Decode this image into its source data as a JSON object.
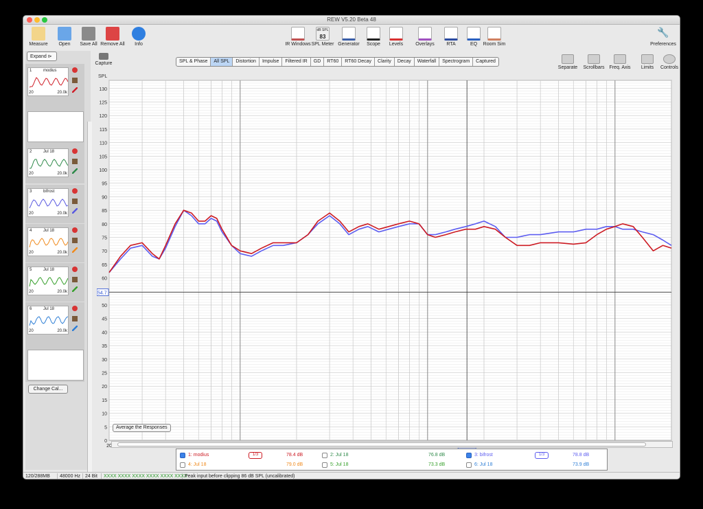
{
  "window": {
    "title": "REW V5.20 Beta 48"
  },
  "toolbar_left": [
    {
      "id": "measure",
      "label": "Measure",
      "icon": "measure-icon"
    },
    {
      "id": "open",
      "label": "Open",
      "icon": "folder-icon"
    },
    {
      "id": "save_all",
      "label": "Save All",
      "icon": "save-icon"
    },
    {
      "id": "remove_all",
      "label": "Remove All",
      "icon": "remove-icon"
    },
    {
      "id": "info",
      "label": "Info",
      "icon": "info-icon"
    }
  ],
  "toolbar_center": [
    {
      "id": "ir_windows",
      "label": "IR Windows",
      "icon": "ir-windows-icon"
    },
    {
      "id": "spl_meter",
      "label": "SPL Meter",
      "icon": "spl-meter-icon",
      "display": "83",
      "unit": "dB SPL"
    },
    {
      "id": "generator",
      "label": "Generator",
      "icon": "generator-icon"
    },
    {
      "id": "scope",
      "label": "Scope",
      "icon": "scope-icon"
    },
    {
      "id": "levels",
      "label": "Levels",
      "icon": "levels-icon"
    },
    {
      "id": "overlays",
      "label": "Overlays",
      "icon": "overlays-icon"
    },
    {
      "id": "rta",
      "label": "RTA",
      "icon": "rta-icon"
    },
    {
      "id": "eq",
      "label": "EQ",
      "icon": "eq-icon"
    },
    {
      "id": "room_sim",
      "label": "Room Sim",
      "icon": "room-sim-icon"
    }
  ],
  "preferences": {
    "label": "Preferences",
    "icon": "wrench-icon"
  },
  "capture": {
    "label": "Capture",
    "icon": "camera-icon"
  },
  "tabs": [
    "SPL & Phase",
    "All SPL",
    "Distortion",
    "Impulse",
    "Filtered IR",
    "GD",
    "RT60",
    "RT60 Decay",
    "Clarity",
    "Decay",
    "Waterfall",
    "Spectrogram",
    "Captured"
  ],
  "active_tab": "All SPL",
  "toolbar_right": [
    {
      "id": "separate",
      "label": "Separate",
      "icon": "separate-icon"
    },
    {
      "id": "scrollbars",
      "label": "Scrollbars",
      "icon": "scrollbars-icon"
    },
    {
      "id": "freq_axis",
      "label": "Freq. Axis",
      "icon": "freq-axis-icon"
    },
    {
      "id": "limits",
      "label": "Limits",
      "icon": "limits-icon"
    },
    {
      "id": "controls",
      "label": "Controls",
      "icon": "gear-icon"
    }
  ],
  "sidebar": {
    "expand_label": "Expand",
    "change_cal_label": "Change Cal...",
    "x_min": "20",
    "x_max": "20.0k",
    "measurements": [
      {
        "num": "1",
        "name": "modius",
        "color": "#d0202a"
      },
      {
        "num": "2",
        "name": "Jul 18",
        "color": "#2f8a4a"
      },
      {
        "num": "3",
        "name": "bifrost",
        "color": "#5a5ae0"
      },
      {
        "num": "4",
        "name": "Jul 18",
        "color": "#f08a1c"
      },
      {
        "num": "5",
        "name": "Jul 18",
        "color": "#37a02c"
      },
      {
        "num": "6",
        "name": "Jul 18",
        "color": "#2f7fd6"
      }
    ]
  },
  "graph": {
    "y_axis_label": "SPL",
    "y_ticks": [
      130,
      125,
      120,
      115,
      110,
      105,
      100,
      95,
      90,
      85,
      80,
      75,
      70,
      65,
      60,
      55,
      50,
      45,
      40,
      35,
      30,
      25,
      20,
      15,
      10,
      5,
      0
    ],
    "y_cursor": "54.7",
    "x_cursor": "1.622k",
    "x_ticks": [
      "20",
      "30",
      "40",
      "50",
      "60",
      "70",
      "80",
      "90",
      "100",
      "200",
      "300",
      "400",
      "500",
      "600",
      "700",
      "900",
      "1k",
      "2k",
      "3k",
      "4k",
      "5k",
      "6k",
      "7k",
      "8k",
      "9k",
      "10k",
      "13k",
      "16k",
      "20kHz"
    ],
    "average_button_label": "Average the Responses"
  },
  "chart_data": {
    "type": "line",
    "xlabel": "",
    "ylabel": "SPL",
    "x_scale": "log",
    "xlim": [
      20,
      20000
    ],
    "ylim": [
      0,
      133
    ],
    "grid": true,
    "series": [
      {
        "name": "1: modius",
        "color": "#cc1a22",
        "x": [
          20,
          23,
          26,
          30,
          34,
          37,
          40,
          45,
          50,
          55,
          60,
          65,
          70,
          75,
          80,
          90,
          100,
          115,
          130,
          150,
          170,
          200,
          230,
          260,
          300,
          340,
          380,
          430,
          480,
          550,
          620,
          700,
          800,
          900,
          1000,
          1100,
          1250,
          1400,
          1600,
          1800,
          2000,
          2300,
          2600,
          3000,
          3500,
          4000,
          5000,
          6000,
          7000,
          8000,
          9000,
          10000,
          11000,
          12500,
          14000,
          16000,
          18000,
          20000
        ],
        "y": [
          62,
          68,
          72,
          73,
          69,
          67,
          72,
          80,
          85,
          84,
          81,
          81,
          83,
          82,
          78,
          72,
          70,
          69,
          71,
          73,
          73,
          73,
          76,
          81,
          84,
          81,
          77,
          79,
          80,
          78,
          79,
          80,
          81,
          80,
          76,
          75,
          76,
          77,
          78,
          78,
          79,
          78,
          75,
          72,
          72,
          73,
          73,
          72.5,
          73,
          76,
          78,
          79,
          80,
          79,
          75,
          70,
          72,
          71
        ]
      },
      {
        "name": "3: bifrost",
        "color": "#5c5cf0",
        "x": [
          20,
          23,
          26,
          30,
          34,
          37,
          40,
          45,
          50,
          55,
          60,
          65,
          70,
          75,
          80,
          90,
          100,
          115,
          130,
          150,
          170,
          200,
          230,
          260,
          300,
          340,
          380,
          430,
          480,
          550,
          620,
          700,
          800,
          900,
          1000,
          1100,
          1250,
          1400,
          1600,
          1800,
          2000,
          2300,
          2600,
          3000,
          3500,
          4000,
          5000,
          6000,
          7000,
          8000,
          9000,
          10000,
          11000,
          12500,
          14000,
          16000,
          18000,
          20000
        ],
        "y": [
          62,
          67,
          71,
          72,
          68,
          67,
          71,
          79,
          85,
          83,
          80,
          80,
          82,
          81,
          77,
          72,
          69,
          68,
          70,
          72,
          72,
          73,
          76,
          80,
          83,
          80,
          76,
          78,
          79,
          77,
          78,
          79,
          80,
          80,
          76,
          76,
          77,
          78,
          79,
          80,
          81,
          79,
          75,
          75,
          76,
          76,
          77,
          77,
          78,
          78,
          79,
          79,
          78,
          78,
          77,
          76,
          74,
          72
        ]
      }
    ]
  },
  "legend": [
    {
      "label": "1: modius",
      "value": "78.4 dB",
      "color": "#cc1a22",
      "checked": true,
      "smoothing": "1/3"
    },
    {
      "label": "2: Jul 18",
      "value": "76.8 dB",
      "color": "#2f8a4a",
      "checked": false
    },
    {
      "label": "3: bifrost",
      "value": "78.8 dB",
      "color": "#5c5cf0",
      "checked": true,
      "smoothing": "1/3"
    },
    {
      "label": "4: Jul 18",
      "value": "79.0 dB",
      "color": "#f08a1c",
      "checked": false
    },
    {
      "label": "5: Jul 18",
      "value": "73.3 dB",
      "color": "#37a02c",
      "checked": false
    },
    {
      "label": "6: Jul 18",
      "value": "73.9 dB",
      "color": "#2f7fd6",
      "checked": false
    }
  ],
  "status": {
    "memory": "120/288MB",
    "rate": "48000 Hz",
    "bits": "24 Bit",
    "levels": "XXXX XXXX   XXXX XXXX   XXXX XXXX",
    "message": "Peak input before clipping 86 dB SPL (uncalibrated)"
  }
}
